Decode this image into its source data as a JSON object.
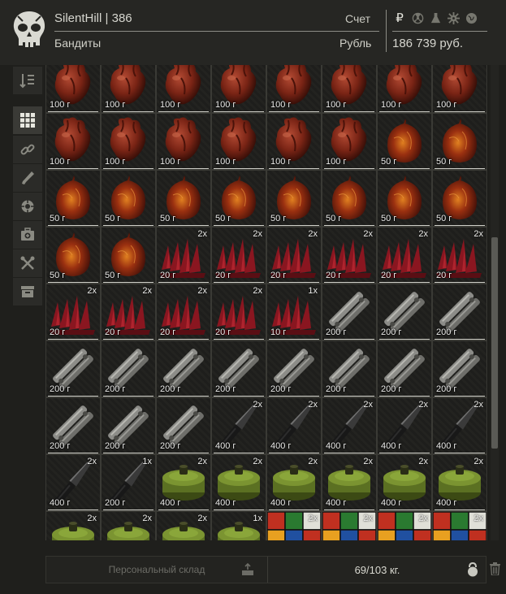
{
  "header": {
    "username": "SilentHill",
    "separator": "|",
    "level": "386",
    "account_label": "Счет",
    "faction": "Бандиты",
    "currency_label": "Рубль",
    "balance": "186 739 руб.",
    "currency_symbol": "₽",
    "currency_icons": [
      "radiation-icon",
      "flask-icon",
      "gear-icon",
      "globe-icon"
    ]
  },
  "sidebar": {
    "items": [
      {
        "name": "sort-icon",
        "active": false
      },
      {
        "name": "all-items-grid-icon",
        "active": true
      },
      {
        "name": "link-icon",
        "active": false
      },
      {
        "name": "weapon-icon",
        "active": false
      },
      {
        "name": "grenade-icon",
        "active": false
      },
      {
        "name": "medkit-icon",
        "active": false
      },
      {
        "name": "tools-icon",
        "active": false
      },
      {
        "name": "box-icon",
        "active": false
      }
    ]
  },
  "grid": {
    "items": [
      {
        "type": "heart",
        "weight": "100 г",
        "count": ""
      },
      {
        "type": "heart",
        "weight": "100 г",
        "count": ""
      },
      {
        "type": "heart",
        "weight": "100 г",
        "count": ""
      },
      {
        "type": "heart",
        "weight": "100 г",
        "count": ""
      },
      {
        "type": "heart",
        "weight": "100 г",
        "count": ""
      },
      {
        "type": "heart",
        "weight": "100 г",
        "count": ""
      },
      {
        "type": "heart",
        "weight": "100 г",
        "count": ""
      },
      {
        "type": "heart",
        "weight": "100 г",
        "count": ""
      },
      {
        "type": "heart",
        "weight": "100 г",
        "count": ""
      },
      {
        "type": "heart",
        "weight": "100 г",
        "count": ""
      },
      {
        "type": "heart",
        "weight": "100 г",
        "count": ""
      },
      {
        "type": "heart",
        "weight": "100 г",
        "count": ""
      },
      {
        "type": "heart",
        "weight": "100 г",
        "count": ""
      },
      {
        "type": "heart",
        "weight": "100 г",
        "count": ""
      },
      {
        "type": "bladder",
        "weight": "50 г",
        "count": ""
      },
      {
        "type": "bladder",
        "weight": "50 г",
        "count": ""
      },
      {
        "type": "bladder",
        "weight": "50 г",
        "count": ""
      },
      {
        "type": "bladder",
        "weight": "50 г",
        "count": ""
      },
      {
        "type": "bladder",
        "weight": "50 г",
        "count": ""
      },
      {
        "type": "bladder",
        "weight": "50 г",
        "count": ""
      },
      {
        "type": "bladder",
        "weight": "50 г",
        "count": ""
      },
      {
        "type": "bladder",
        "weight": "50 г",
        "count": ""
      },
      {
        "type": "bladder",
        "weight": "50 г",
        "count": ""
      },
      {
        "type": "bladder",
        "weight": "50 г",
        "count": ""
      },
      {
        "type": "bladder",
        "weight": "50 г",
        "count": ""
      },
      {
        "type": "bladder",
        "weight": "50 г",
        "count": ""
      },
      {
        "type": "claws",
        "weight": "20 г",
        "count": "2x"
      },
      {
        "type": "claws",
        "weight": "20 г",
        "count": "2x"
      },
      {
        "type": "claws",
        "weight": "20 г",
        "count": "2x"
      },
      {
        "type": "claws",
        "weight": "20 г",
        "count": "2x"
      },
      {
        "type": "claws",
        "weight": "20 г",
        "count": "2x"
      },
      {
        "type": "claws",
        "weight": "20 г",
        "count": "2x"
      },
      {
        "type": "claws",
        "weight": "20 г",
        "count": "2x"
      },
      {
        "type": "claws",
        "weight": "20 г",
        "count": "2x"
      },
      {
        "type": "claws",
        "weight": "20 г",
        "count": "2x"
      },
      {
        "type": "claws",
        "weight": "20 г",
        "count": "2x"
      },
      {
        "type": "claws",
        "weight": "10 г",
        "count": "1x"
      },
      {
        "type": "multitool",
        "weight": "200 г",
        "count": ""
      },
      {
        "type": "multitool",
        "weight": "200 г",
        "count": ""
      },
      {
        "type": "multitool",
        "weight": "200 г",
        "count": ""
      },
      {
        "type": "multitool",
        "weight": "200 г",
        "count": ""
      },
      {
        "type": "multitool",
        "weight": "200 г",
        "count": ""
      },
      {
        "type": "multitool",
        "weight": "200 г",
        "count": ""
      },
      {
        "type": "multitool",
        "weight": "200 г",
        "count": ""
      },
      {
        "type": "multitool",
        "weight": "200 г",
        "count": ""
      },
      {
        "type": "multitool",
        "weight": "200 г",
        "count": ""
      },
      {
        "type": "multitool",
        "weight": "200 г",
        "count": ""
      },
      {
        "type": "multitool",
        "weight": "200 г",
        "count": ""
      },
      {
        "type": "multitool",
        "weight": "200 г",
        "count": ""
      },
      {
        "type": "multitool",
        "weight": "200 г",
        "count": ""
      },
      {
        "type": "multitool",
        "weight": "200 г",
        "count": ""
      },
      {
        "type": "knife",
        "weight": "400 г",
        "count": "2x"
      },
      {
        "type": "knife",
        "weight": "400 г",
        "count": "2x"
      },
      {
        "type": "knife",
        "weight": "400 г",
        "count": "2x"
      },
      {
        "type": "knife",
        "weight": "400 г",
        "count": "2x"
      },
      {
        "type": "knife",
        "weight": "400 г",
        "count": "2x"
      },
      {
        "type": "knife",
        "weight": "400 г",
        "count": "2x"
      },
      {
        "type": "knife",
        "weight": "200 г",
        "count": "1x"
      },
      {
        "type": "can",
        "weight": "400 г",
        "count": "2x"
      },
      {
        "type": "can",
        "weight": "400 г",
        "count": "2x"
      },
      {
        "type": "can",
        "weight": "400 г",
        "count": "2x"
      },
      {
        "type": "can",
        "weight": "400 г",
        "count": "2x"
      },
      {
        "type": "can",
        "weight": "400 г",
        "count": "2x"
      },
      {
        "type": "can",
        "weight": "400 г",
        "count": "2x"
      },
      {
        "type": "can",
        "weight": "",
        "count": "2x"
      },
      {
        "type": "can",
        "weight": "",
        "count": "2x"
      },
      {
        "type": "can",
        "weight": "",
        "count": "2x"
      },
      {
        "type": "can",
        "weight": "",
        "count": "1x"
      },
      {
        "type": "cube",
        "weight": "",
        "count": "2x"
      },
      {
        "type": "cube",
        "weight": "",
        "count": "2x"
      },
      {
        "type": "cube",
        "weight": "",
        "count": "2x"
      },
      {
        "type": "cube",
        "weight": "",
        "count": "2x"
      }
    ]
  },
  "footer": {
    "stash_label": "Персональный склад",
    "weight": "69/103 кг."
  }
}
